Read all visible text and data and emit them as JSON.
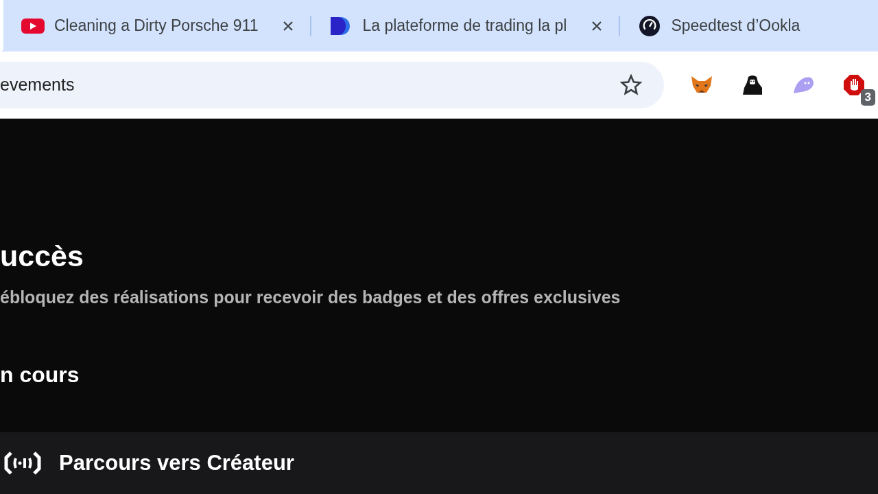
{
  "tabs": [
    {
      "title": "Cleaning a Dirty Porsche 911",
      "kind": "video",
      "closable": true
    },
    {
      "title": "La plateforme de trading la pl",
      "kind": "d",
      "closable": true
    },
    {
      "title": "Speedtest d’Ookla",
      "kind": "gauge",
      "closable": false
    }
  ],
  "address_bar": {
    "value": "evements",
    "bookmarked": false
  },
  "extensions": [
    {
      "kind": "fox"
    },
    {
      "kind": "gorilla"
    },
    {
      "kind": "ghost"
    },
    {
      "kind": "stop",
      "badge": "3"
    }
  ],
  "page": {
    "title": "uccès",
    "subtitle": "ébloquez des réalisations pour recevoir des badges et des offres exclusives",
    "section": "n cours",
    "card": {
      "title": "Parcours vers Créateur"
    }
  }
}
